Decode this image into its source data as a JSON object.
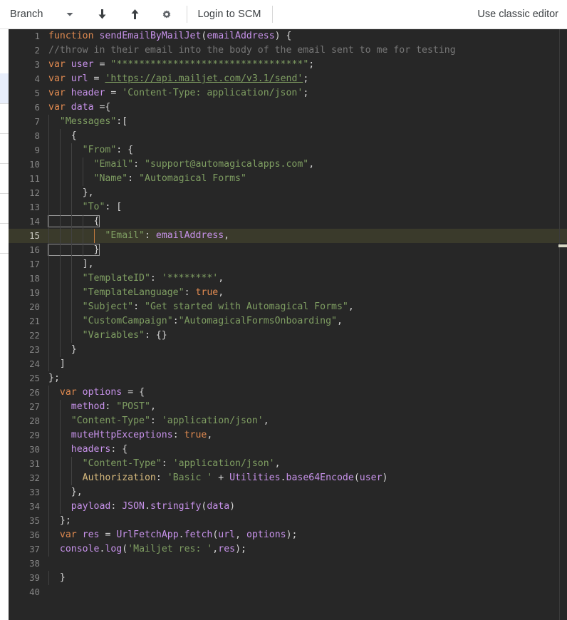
{
  "toolbar": {
    "branch_label": "Branch",
    "dropdown_icon": "chevron-down-icon",
    "pull_icon": "arrow-down-icon",
    "push_icon": "arrow-up-icon",
    "settings_icon": "gear-icon",
    "login_label": "Login to SCM",
    "classic_editor_label": "Use classic editor"
  },
  "editor": {
    "current_line": 15,
    "total_lines": 40,
    "colors": {
      "background": "#272727",
      "current_line_bg": "#3a3a2b",
      "keyword": "#e08a50",
      "identifier": "#c792ea",
      "string": "#7f9e62",
      "comment": "#777777",
      "property": "#d7ba7d",
      "line_number": "#858585",
      "indent_guide": "#424242",
      "indent_guide_active": "#c07a3e"
    },
    "lines": [
      {
        "n": 1,
        "text": "function sendEmailByMailJet(emailAddress) {"
      },
      {
        "n": 2,
        "text": "//throw in their email into the body of the email sent to me for testing"
      },
      {
        "n": 3,
        "text": "var user = \"*********************************\";"
      },
      {
        "n": 4,
        "text": "var url = 'https://api.mailjet.com/v3.1/send';"
      },
      {
        "n": 5,
        "text": "var header = 'Content-Type: application/json';"
      },
      {
        "n": 6,
        "text": "var data ={"
      },
      {
        "n": 7,
        "text": "  \"Messages\":["
      },
      {
        "n": 8,
        "text": "    {"
      },
      {
        "n": 9,
        "text": "      \"From\": {"
      },
      {
        "n": 10,
        "text": "        \"Email\": \"support@automagicalapps.com\","
      },
      {
        "n": 11,
        "text": "        \"Name\": \"Automagical Forms\""
      },
      {
        "n": 12,
        "text": "      },"
      },
      {
        "n": 13,
        "text": "      \"To\": ["
      },
      {
        "n": 14,
        "text": "        {"
      },
      {
        "n": 15,
        "text": "          \"Email\": emailAddress,"
      },
      {
        "n": 16,
        "text": "        }"
      },
      {
        "n": 17,
        "text": "      ],"
      },
      {
        "n": 18,
        "text": "      \"TemplateID\": '********',"
      },
      {
        "n": 19,
        "text": "      \"TemplateLanguage\": true,"
      },
      {
        "n": 20,
        "text": "      \"Subject\": \"Get started with Automagical Forms\","
      },
      {
        "n": 21,
        "text": "      \"CustomCampaign\":\"AutomagicalFormsOnboarding\","
      },
      {
        "n": 22,
        "text": "      \"Variables\": {}"
      },
      {
        "n": 23,
        "text": "    }"
      },
      {
        "n": 24,
        "text": "  ]"
      },
      {
        "n": 25,
        "text": "};"
      },
      {
        "n": 26,
        "text": "  var options = {"
      },
      {
        "n": 27,
        "text": "    method: \"POST\","
      },
      {
        "n": 28,
        "text": "    \"Content-Type\": 'application/json',"
      },
      {
        "n": 29,
        "text": "    muteHttpExceptions: true,"
      },
      {
        "n": 30,
        "text": "    headers: {"
      },
      {
        "n": 31,
        "text": "      \"Content-Type\": 'application/json',"
      },
      {
        "n": 32,
        "text": "      Authorization: 'Basic ' + Utilities.base64Encode(user)"
      },
      {
        "n": 33,
        "text": "    },"
      },
      {
        "n": 34,
        "text": "    payload: JSON.stringify(data)"
      },
      {
        "n": 35,
        "text": "  };"
      },
      {
        "n": 36,
        "text": "  var res = UrlFetchApp.fetch(url, options);"
      },
      {
        "n": 37,
        "text": "  console.log('Mailjet res: ',res);"
      },
      {
        "n": 38,
        "text": ""
      },
      {
        "n": 39,
        "text": "  }"
      },
      {
        "n": 40,
        "text": ""
      }
    ]
  }
}
